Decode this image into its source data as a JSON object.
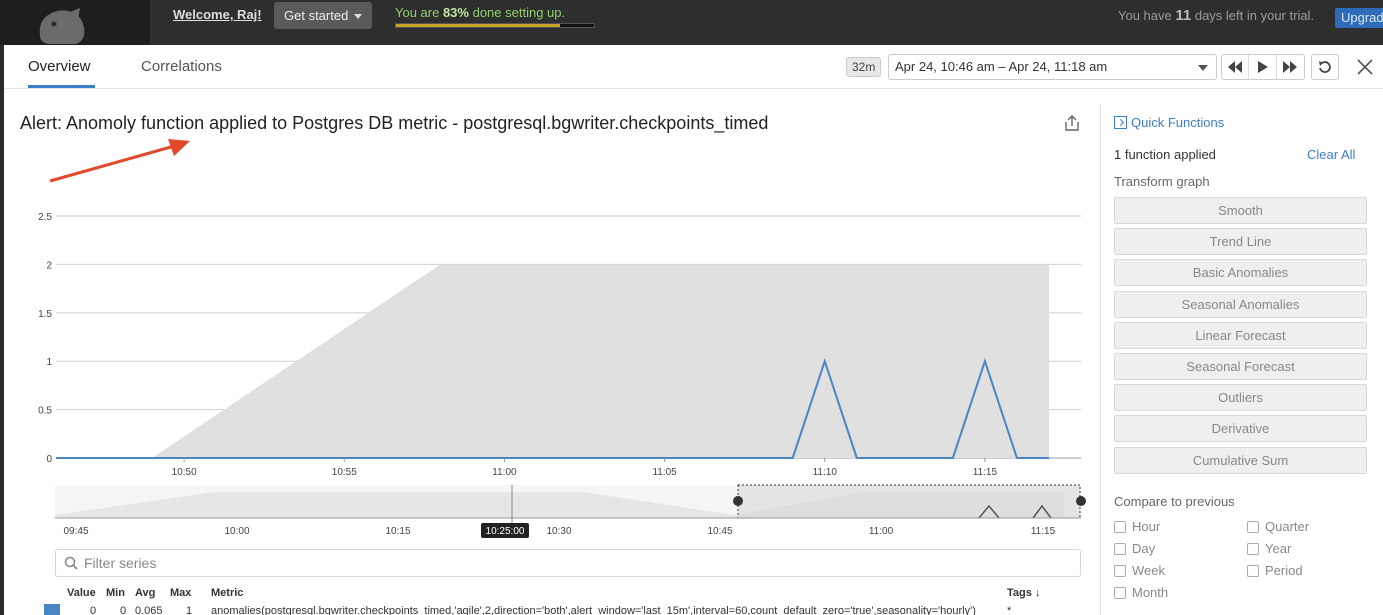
{
  "topbar": {
    "welcome": "Welcome, Raj!",
    "get_started": "Get started",
    "setup_prefix": "You are ",
    "setup_percent": "83%",
    "setup_suffix": " done setting up.",
    "setup_progress": 0.83,
    "trial_prefix": "You have ",
    "trial_days": "11",
    "trial_suffix": " days left in your trial.",
    "upgrade": "Upgrade"
  },
  "modal": {
    "tabs": [
      {
        "label": "Overview",
        "active": true
      },
      {
        "label": "Correlations",
        "active": false
      }
    ],
    "span_badge": "32m",
    "timeframe": "Apr 24, 10:46 am – Apr 24, 11:18 am"
  },
  "graph": {
    "title": "Alert: Anomoly function applied to Postgres DB metric - postgresql.bgwriter.checkpoints_timed"
  },
  "chart_data": {
    "type": "line",
    "y_ticks": [
      "0",
      "0.5",
      "1",
      "1.5",
      "2",
      "2.5"
    ],
    "ylim": [
      0,
      2.5
    ],
    "x_ticks": [
      "10:50",
      "10:55",
      "11:00",
      "11:05",
      "11:10",
      "11:15"
    ],
    "bands_color": "#e0e0e0",
    "line_color": "#4a86c5",
    "series": [
      {
        "x": [
          "10:46",
          "10:47",
          "10:49",
          "11:09",
          "11:10",
          "11:11",
          "11:14",
          "11:15",
          "11:16",
          "11:17"
        ],
        "values": [
          0,
          0,
          0,
          0,
          1,
          0,
          0,
          1,
          0,
          0
        ]
      }
    ],
    "band": {
      "x": [
        "10:47",
        "10:49",
        "10:58",
        "11:17"
      ],
      "upper": [
        0,
        0,
        2,
        2
      ]
    },
    "navigator": {
      "ticks": [
        "09:45",
        "10:00",
        "10:15",
        "10:25:00",
        "10:30",
        "10:45",
        "11:00",
        "11:15"
      ],
      "cursor_label": "10:25:00"
    }
  },
  "filter": {
    "placeholder": "Filter series"
  },
  "legend": {
    "headers": {
      "value": "Value",
      "min": "Min",
      "avg": "Avg",
      "max": "Max",
      "metric": "Metric",
      "tags": "Tags ↓"
    },
    "row": {
      "value": "0",
      "min": "0",
      "avg": "0.065",
      "max": "1",
      "metric": "anomalies(postgresql.bgwriter.checkpoints_timed,'agile',2,direction='both',alert_window='last_15m',interval=60,count_default_zero='true',seasonality='hourly')",
      "tags": "*",
      "color": "#4a86c5"
    }
  },
  "sidebar": {
    "heading": "Quick Functions",
    "applied": "1 function applied",
    "clear_all": "Clear All",
    "transform_label": "Transform graph",
    "functions": [
      "Smooth",
      "Trend Line",
      "Basic Anomalies",
      "Seasonal Anomalies",
      "Linear Forecast",
      "Seasonal Forecast",
      "Outliers",
      "Derivative",
      "Cumulative Sum"
    ],
    "compare_label": "Compare to previous",
    "compare_left": [
      "Hour",
      "Day",
      "Week",
      "Month"
    ],
    "compare_right": [
      "Quarter",
      "Year",
      "Period"
    ]
  }
}
